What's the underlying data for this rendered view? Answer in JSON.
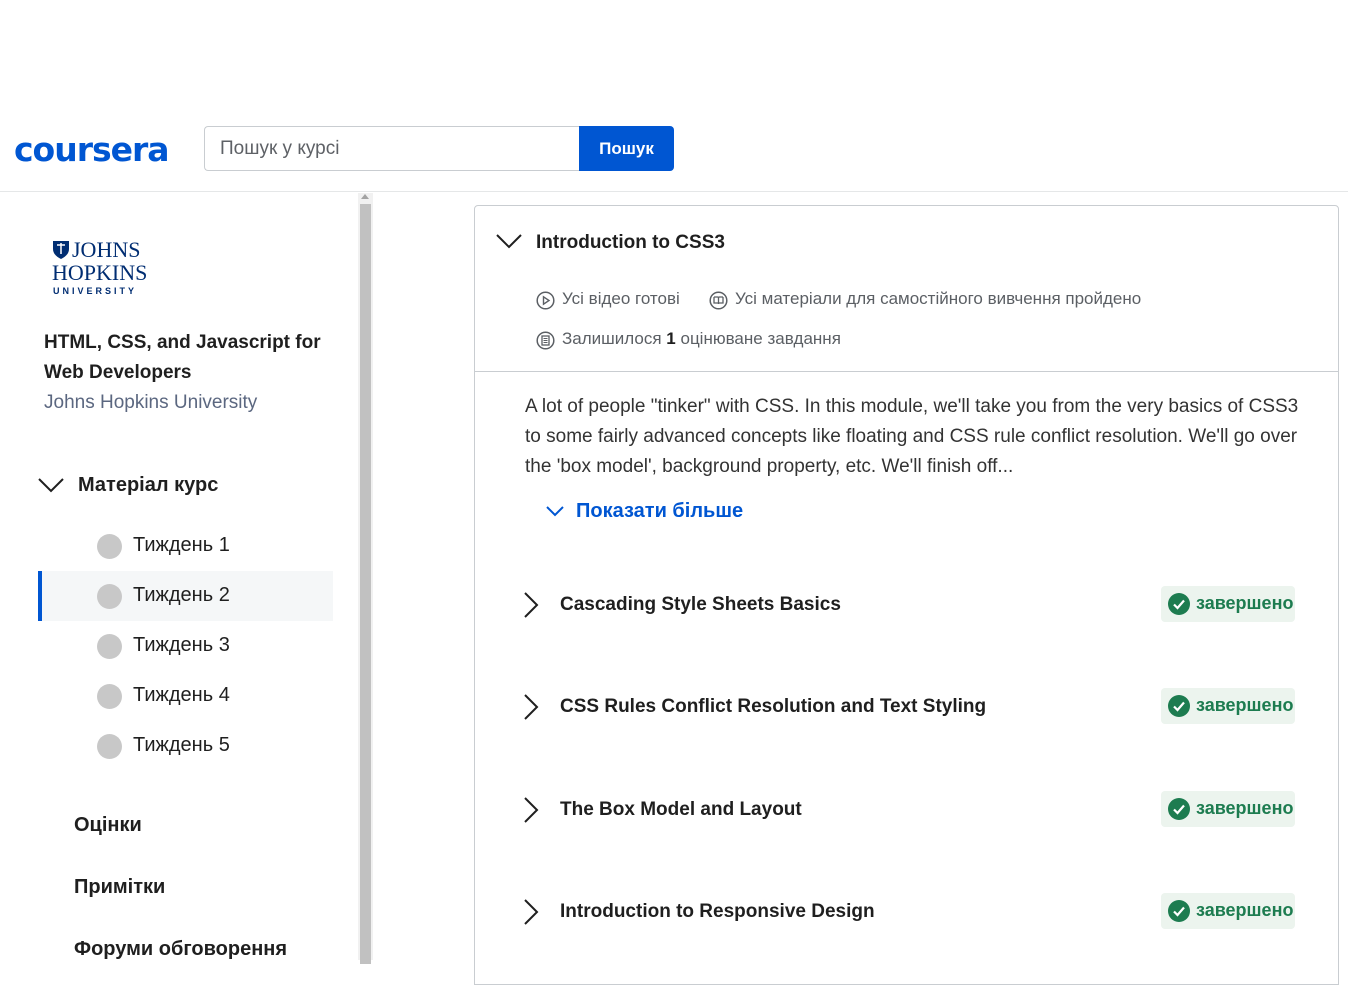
{
  "header": {
    "logo": "coursera",
    "search_placeholder": "Пошук у курсі",
    "search_button": "Пошук"
  },
  "sidebar": {
    "partner_logo": {
      "line1": "JOHNS",
      "line2": "HOPKINS",
      "line3": "UNIVERSITY"
    },
    "course_title": "HTML, CSS, and Javascript for Web Developers",
    "course_partner": "Johns Hopkins University",
    "material_label": "Матеріал курс",
    "weeks": [
      {
        "label": "Тиждень 1",
        "active": false
      },
      {
        "label": "Тиждень 2",
        "active": true
      },
      {
        "label": "Тиждень 3",
        "active": false
      },
      {
        "label": "Тиждень 4",
        "active": false
      },
      {
        "label": "Тиждень 5",
        "active": false
      }
    ],
    "links": [
      "Оцінки",
      "Примітки",
      "Форуми обговорення"
    ]
  },
  "module": {
    "title": "Introduction to CSS3",
    "meta_videos": "Усі відео готові",
    "meta_readings": "Усі матеріали для самостійного вивчення пройдено",
    "meta_remaining_prefix": "Залишилося",
    "meta_remaining_count": "1",
    "meta_remaining_suffix": "оцінюване завдання",
    "description": "A lot of people \"tinker\" with CSS. In this module, we'll take you from the very basics of CSS3 to some fairly advanced concepts like floating and CSS rule conflict resolution. We'll go over the 'box model', background property, etc. We'll finish off...",
    "show_more": "Показати більше",
    "lessons": [
      {
        "name": "Cascading Style Sheets Basics",
        "status": "завершено"
      },
      {
        "name": "CSS Rules Conflict Resolution and Text Styling",
        "status": "завершено"
      },
      {
        "name": "The Box Model and Layout",
        "status": "завершено"
      },
      {
        "name": "Introduction to Responsive Design",
        "status": "завершено"
      }
    ]
  },
  "colors": {
    "brand": "#0056d2",
    "success": "#1d7c50",
    "success_bg": "#ecf4ee"
  }
}
